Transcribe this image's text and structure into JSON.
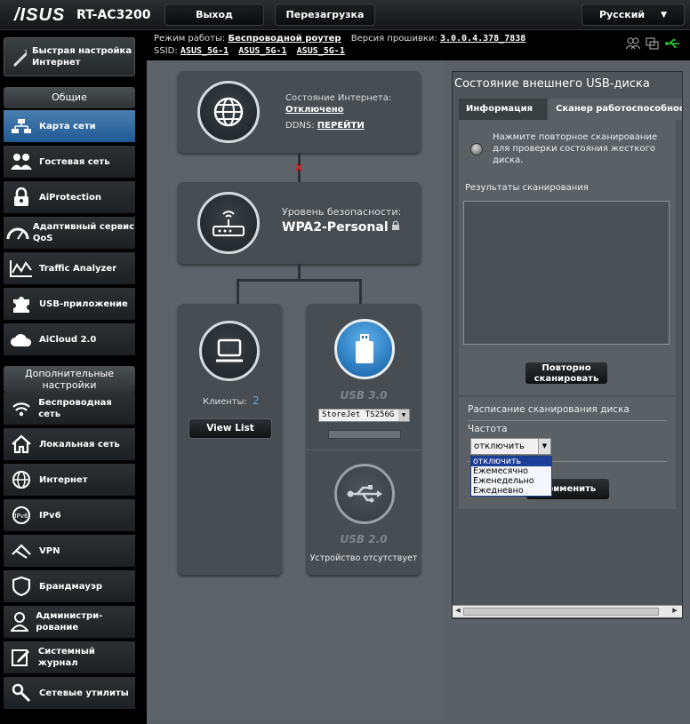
{
  "header": {
    "brand": "/ISUS",
    "model": "RT-AC3200",
    "logout_label": "Выход",
    "reboot_label": "Перезагрузка",
    "language": "Русский"
  },
  "info": {
    "mode_label": "Режим работы:",
    "mode_value": "Беспроводной роутер",
    "firmware_label": "Версия прошивки:",
    "firmware_value": "3.0.0.4.378_7838",
    "ssid_label": "SSID:",
    "ssids": [
      "ASUS_5G-1",
      "ASUS_5G-1",
      "ASUS_5G-1"
    ]
  },
  "sidebar": {
    "quick_setup": "Быстрая настройка Интернет",
    "general_header": "Общие",
    "general_items": [
      {
        "label": "Карта сети",
        "icon": "network-map-icon"
      },
      {
        "label": "Гостевая сеть",
        "icon": "guest-network-icon"
      },
      {
        "label": "AiProtection",
        "icon": "lock-icon"
      },
      {
        "label": "Адаптивный сервис QoS",
        "icon": "speedometer-icon"
      },
      {
        "label": "Traffic Analyzer",
        "icon": "chart-icon"
      },
      {
        "label": "USB-приложение",
        "icon": "puzzle-icon"
      },
      {
        "label": "AiCloud 2.0",
        "icon": "cloud-icon"
      }
    ],
    "advanced_header": "Дополнительные настройки",
    "advanced_items": [
      {
        "label": "Беспроводная сеть",
        "icon": "wireless-icon"
      },
      {
        "label": "Локальная сеть",
        "icon": "home-icon"
      },
      {
        "label": "Интернет",
        "icon": "globe-icon"
      },
      {
        "label": "IPv6",
        "icon": "ipv6-icon"
      },
      {
        "label": "VPN",
        "icon": "vpn-icon"
      },
      {
        "label": "Брандмауэр",
        "icon": "shield-icon"
      },
      {
        "label": "Администри-рование",
        "icon": "user-icon"
      },
      {
        "label": "Системный журнал",
        "icon": "log-icon"
      },
      {
        "label": "Сетевые утилиты",
        "icon": "tools-icon"
      }
    ]
  },
  "map": {
    "internet_status_label": "Состояние Интернета:",
    "internet_status_value": "Отключено",
    "ddns_label": "DDNS:",
    "ddns_link": "ПЕРЕЙТИ",
    "security_label": "Уровень безопасности:",
    "security_value": "WPA2-Personal",
    "clients_label": "Клиенты:",
    "clients_count": "2",
    "view_list": "View List",
    "usb30_label": "USB 3.0",
    "usb30_device": "StoreJet TS256G",
    "usb20_label": "USB 2.0",
    "usb20_status": "Устройство отсутствует"
  },
  "panel": {
    "title": "Состояние внешнего USB-диска",
    "tab_info": "Информация",
    "tab_scanner": "Сканер работоспособности",
    "scan_hint": "Нажмите повторное сканирование для проверки состояния жесткого диска.",
    "results_label": "Результаты сканирования",
    "rescan_label": "Повторно сканировать",
    "schedule_title": "Расписание сканирования диска",
    "frequency_label": "Частота",
    "frequency_value": "отключить",
    "frequency_options": [
      "отключить",
      "Ежемесячно",
      "Еженедельно",
      "Ежедневно"
    ],
    "apply_label": "Применить"
  }
}
